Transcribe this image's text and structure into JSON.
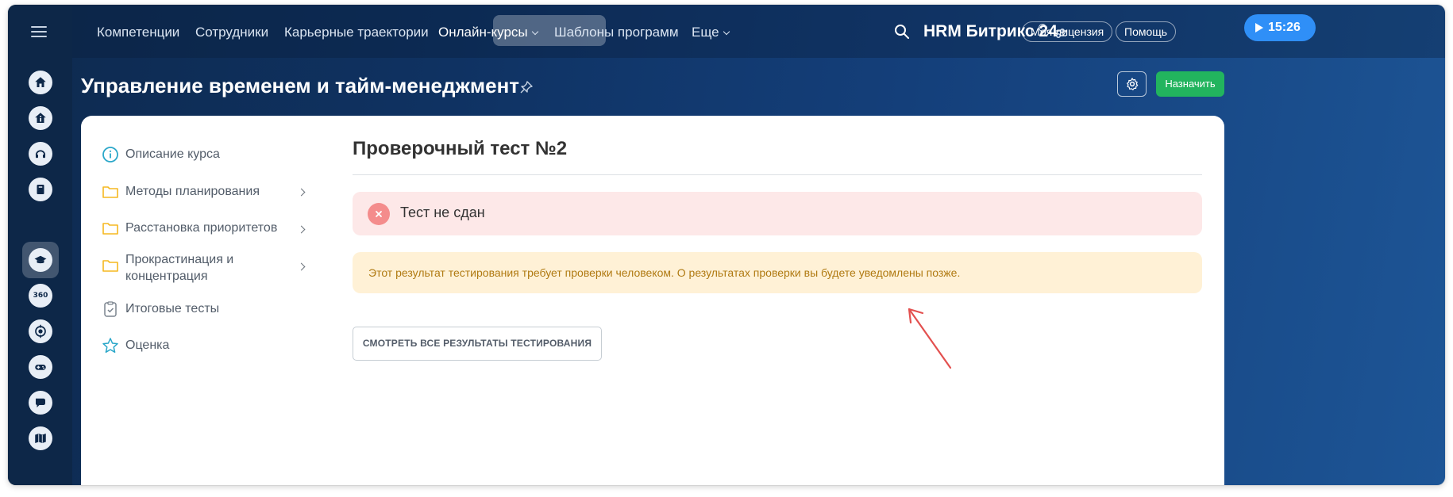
{
  "topnav": {
    "items": [
      {
        "label": "Компетенции"
      },
      {
        "label": "Сотрудники"
      },
      {
        "label": "Карьерные траектории"
      },
      {
        "label": "Онлайн-курсы"
      },
      {
        "label": "Шаблоны программ"
      },
      {
        "label": "Еще"
      }
    ],
    "active_index": 3,
    "brand": "HRM Битрикс 24",
    "license_label": "Моя лицензия",
    "help_label": "Помощь",
    "time": "15:26"
  },
  "sidebar": {
    "icons": [
      "home-icon",
      "info-icon",
      "support-icon",
      "book-icon",
      "graduation-cap-icon",
      "rating-360-icon",
      "target-icon",
      "gamepad-icon",
      "chat-icon",
      "map-icon"
    ],
    "active_icon": "graduation-cap-icon"
  },
  "page": {
    "title": "Управление временем и тайм-менеджмент",
    "assign_label": "Назначить"
  },
  "course_menu": {
    "items": [
      {
        "label": "Описание курса",
        "icon": "info-circle-icon",
        "has_children": false
      },
      {
        "label": "Методы планирования",
        "icon": "folder-icon",
        "has_children": true
      },
      {
        "label": "Расстановка приоритетов",
        "icon": "folder-icon",
        "has_children": true
      },
      {
        "label": "Прокрастинация и концентрация",
        "icon": "folder-icon",
        "has_children": true
      },
      {
        "label": "Итоговые тесты",
        "icon": "test-icon",
        "has_children": false
      },
      {
        "label": "Оценка",
        "icon": "star-icon",
        "has_children": false
      }
    ]
  },
  "test": {
    "title": "Проверочный тест №2",
    "status": "Тест не сдан",
    "notice": "Этот результат тестирования требует проверки человеком. О результатах проверки вы будете уведомлены позже.",
    "results_button": "СМОТРЕТЬ ВСЕ РЕЗУЛЬТАТЫ ТЕСТИРОВАНИЯ"
  },
  "colors": {
    "accent": "#2f8ff7",
    "success": "#22b45e",
    "error_bg": "#fde8e8",
    "error_icon": "#f48c8c",
    "warning_bg": "#fff1d6",
    "warning_text": "#b07a12",
    "annotation_arrow": "#e3504f"
  }
}
